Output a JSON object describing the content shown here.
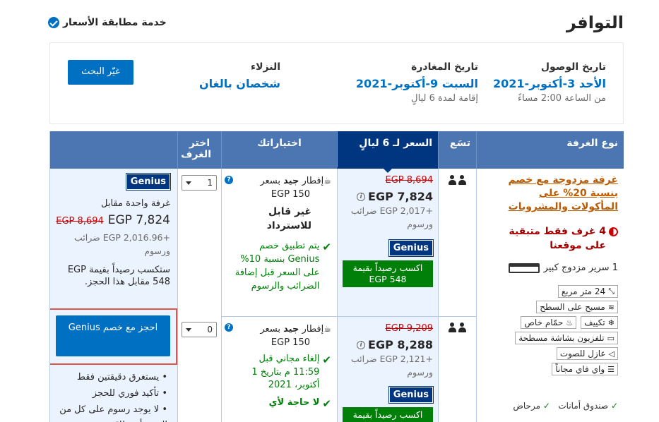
{
  "header": {
    "title": "التوافر",
    "price_match": "خدمة مطابقة الأسعار"
  },
  "search": {
    "checkin": {
      "label": "تاريخ الوصول",
      "value": "الأحد 3-أكتوبر-2021",
      "sub": "من الساعة 2:00 مساءً"
    },
    "checkout": {
      "label": "تاريخ المغادرة",
      "value": "السبت 9-أكتوبر-2021",
      "sub": "إقامة لمدة 6 ليالٍ"
    },
    "guests": {
      "label": "النزلاء",
      "value": "شخصان بالغان"
    },
    "change_button": "غيّر البحث"
  },
  "table": {
    "headers": {
      "room_type": "نوع الغرفة",
      "sleeps": "تسَع",
      "price": "السعر لـ 6 ليالٍ",
      "options": "اختياراتك",
      "select_rooms": "اختر الغرف"
    },
    "room": {
      "name": "غرفة مزدوجة مع خصم بنسبة 20% على المأكولات والمشروبات",
      "scarcity": "4 غرف فقط متبقية على موقعنا",
      "bed": "1 سرير مزدوج كبير",
      "facilities": [
        "24 متر مربع",
        "مسبح على السطح",
        "تكييف",
        "حمّام خاص",
        "تلفزيون بشاشة مسطحة",
        "عازل للصوت",
        "واي فاي مجاناً"
      ],
      "amenities": [
        "صندوق أمانات",
        "مرحاض"
      ]
    },
    "rows": [
      {
        "old_price": "EGP 8,694",
        "price": "EGP 7,824",
        "tax": "+EGP 2,017 ضرائب ورسوم",
        "genius": "Genius",
        "credit": "اكسب رصيداً بقيمة EGP 548",
        "breakfast_prefix": "إفطار",
        "breakfast_word": "جيد",
        "breakfast_suffix": "بسعر",
        "breakfast_price": "EGP 150",
        "policy": "غير قابل للاسترداد",
        "discount": "يتم تطبيق خصم Genius بنسبة 10% على السعر قبل إضافة الضرائب والرسوم",
        "qty": "1"
      },
      {
        "old_price": "EGP 9,209",
        "price": "EGP 8,288",
        "tax": "+EGP 2,121 ضرائب ورسوم",
        "genius": "Genius",
        "credit": "اكسب رصيداً بقيمة",
        "breakfast_prefix": "إفطار",
        "breakfast_word": "جيد",
        "breakfast_suffix": "بسعر",
        "breakfast_price": "EGP 150",
        "policy": "إلغاء مجاني قبل 11:59 م بتاريخ 1 أكتوبر، 2021",
        "extra": "لا حاجة لأي",
        "qty": "0"
      }
    ],
    "summary": {
      "genius": "Genius",
      "for_room": "غرفة واحدة مقابل",
      "total": "EGP 7,824",
      "old_total": "EGP 8,694",
      "tax": "+EGP 2,016.96 ضرائب ورسوم",
      "earn": "ستكسب رصيداً بقيمة EGP 548 مقابل هذا الحجز.",
      "book_button": "احجز مع خصم Genius",
      "bullets": [
        "يستغرق دقيقتين فقط",
        "تأكيد فوري للحجز",
        "لا يوجد رسوم على كل من الحجز أو بطاقة"
      ]
    }
  }
}
